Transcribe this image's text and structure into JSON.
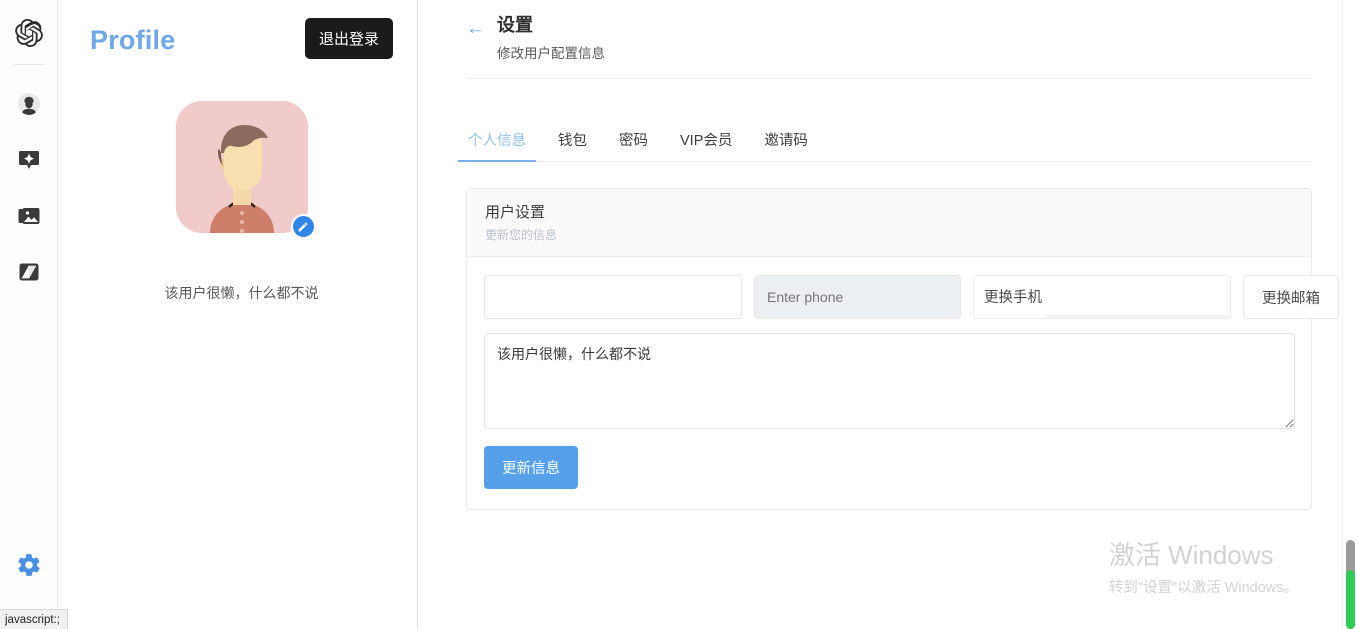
{
  "rail": {
    "logo_icon": "openai-logo-icon",
    "items": [
      {
        "icon": "user-avatar-icon",
        "name": "rail-item-account"
      },
      {
        "icon": "sparkle-badge-icon",
        "name": "rail-item-ai"
      },
      {
        "icon": "image-folder-icon",
        "name": "rail-item-gallery"
      },
      {
        "icon": "image-swap-icon",
        "name": "rail-item-tools"
      }
    ],
    "gear_icon": "gear-icon"
  },
  "statusbar": {
    "text": "javascript:;"
  },
  "profile": {
    "title": "Profile",
    "logout_label": "退出登录",
    "avatar_edit_icon": "pencil-icon",
    "bio": "该用户很懒，什么都不说"
  },
  "page": {
    "back_icon": "arrow-left-icon",
    "title": "设置",
    "subtitle": "修改用户配置信息"
  },
  "tabs": [
    {
      "label": "个人信息",
      "active": true
    },
    {
      "label": "钱包",
      "active": false
    },
    {
      "label": "密码",
      "active": false
    },
    {
      "label": "VIP会员",
      "active": false
    },
    {
      "label": "邀请码",
      "active": false
    }
  ],
  "card": {
    "title": "用户设置",
    "subtitle": "更新您的信息",
    "name_value": "",
    "name_placeholder": "",
    "phone_value": "",
    "phone_placeholder": "Enter phone",
    "change_phone_label": "更换手机",
    "change_email_label": "更换邮箱",
    "bio_value": "该用户很懒，什么都不说",
    "update_label": "更新信息"
  },
  "watermark": {
    "title": "激活 Windows",
    "subtitle": "转到\"设置\"以激活 Windows。"
  },
  "colors": {
    "accent_blue": "#56a0ea",
    "profile_blue": "#6fa8e8",
    "logout_dark": "#1b1b1b",
    "scroll_green": "#2ecc55",
    "avatar_bg": "#f0cbc9"
  }
}
